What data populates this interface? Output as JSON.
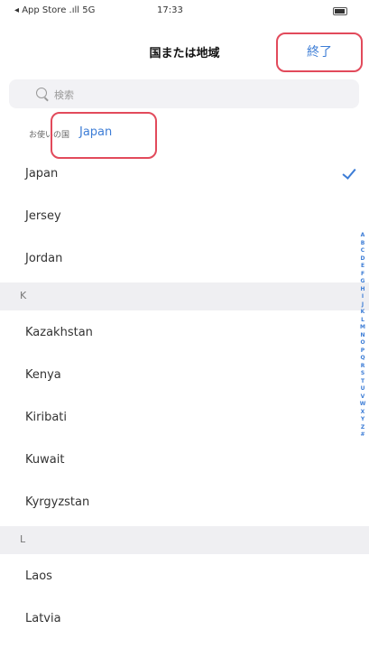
{
  "status_bar": {
    "carrier": "◂ App Store .ıll 5G",
    "time": "17:33"
  },
  "nav": {
    "title": "国または地域",
    "done_label": "終了"
  },
  "search": {
    "placeholder": "検索"
  },
  "current": {
    "label": "お使いの国",
    "value": "Japan"
  },
  "sections": [
    {
      "items": [
        {
          "name": "Japan",
          "selected": true
        },
        {
          "name": "Jersey",
          "selected": false
        },
        {
          "name": "Jordan",
          "selected": false
        }
      ]
    },
    {
      "header": "K",
      "items": [
        {
          "name": "Kazakhstan",
          "selected": false
        },
        {
          "name": "Kenya",
          "selected": false
        },
        {
          "name": "Kiribati",
          "selected": false
        },
        {
          "name": "Kuwait",
          "selected": false
        },
        {
          "name": "Kyrgyzstan",
          "selected": false
        }
      ]
    },
    {
      "header": "L",
      "items": [
        {
          "name": "Laos",
          "selected": false
        },
        {
          "name": "Latvia",
          "selected": false
        }
      ]
    }
  ],
  "index_letters": [
    "A",
    "B",
    "C",
    "D",
    "E",
    "F",
    "G",
    "H",
    "I",
    "J",
    "K",
    "L",
    "M",
    "N",
    "O",
    "P",
    "Q",
    "R",
    "S",
    "T",
    "U",
    "V",
    "W",
    "X",
    "Y",
    "Z",
    "#"
  ],
  "colors": {
    "accent": "#3d7dd6",
    "highlight": "#e24a5b"
  }
}
